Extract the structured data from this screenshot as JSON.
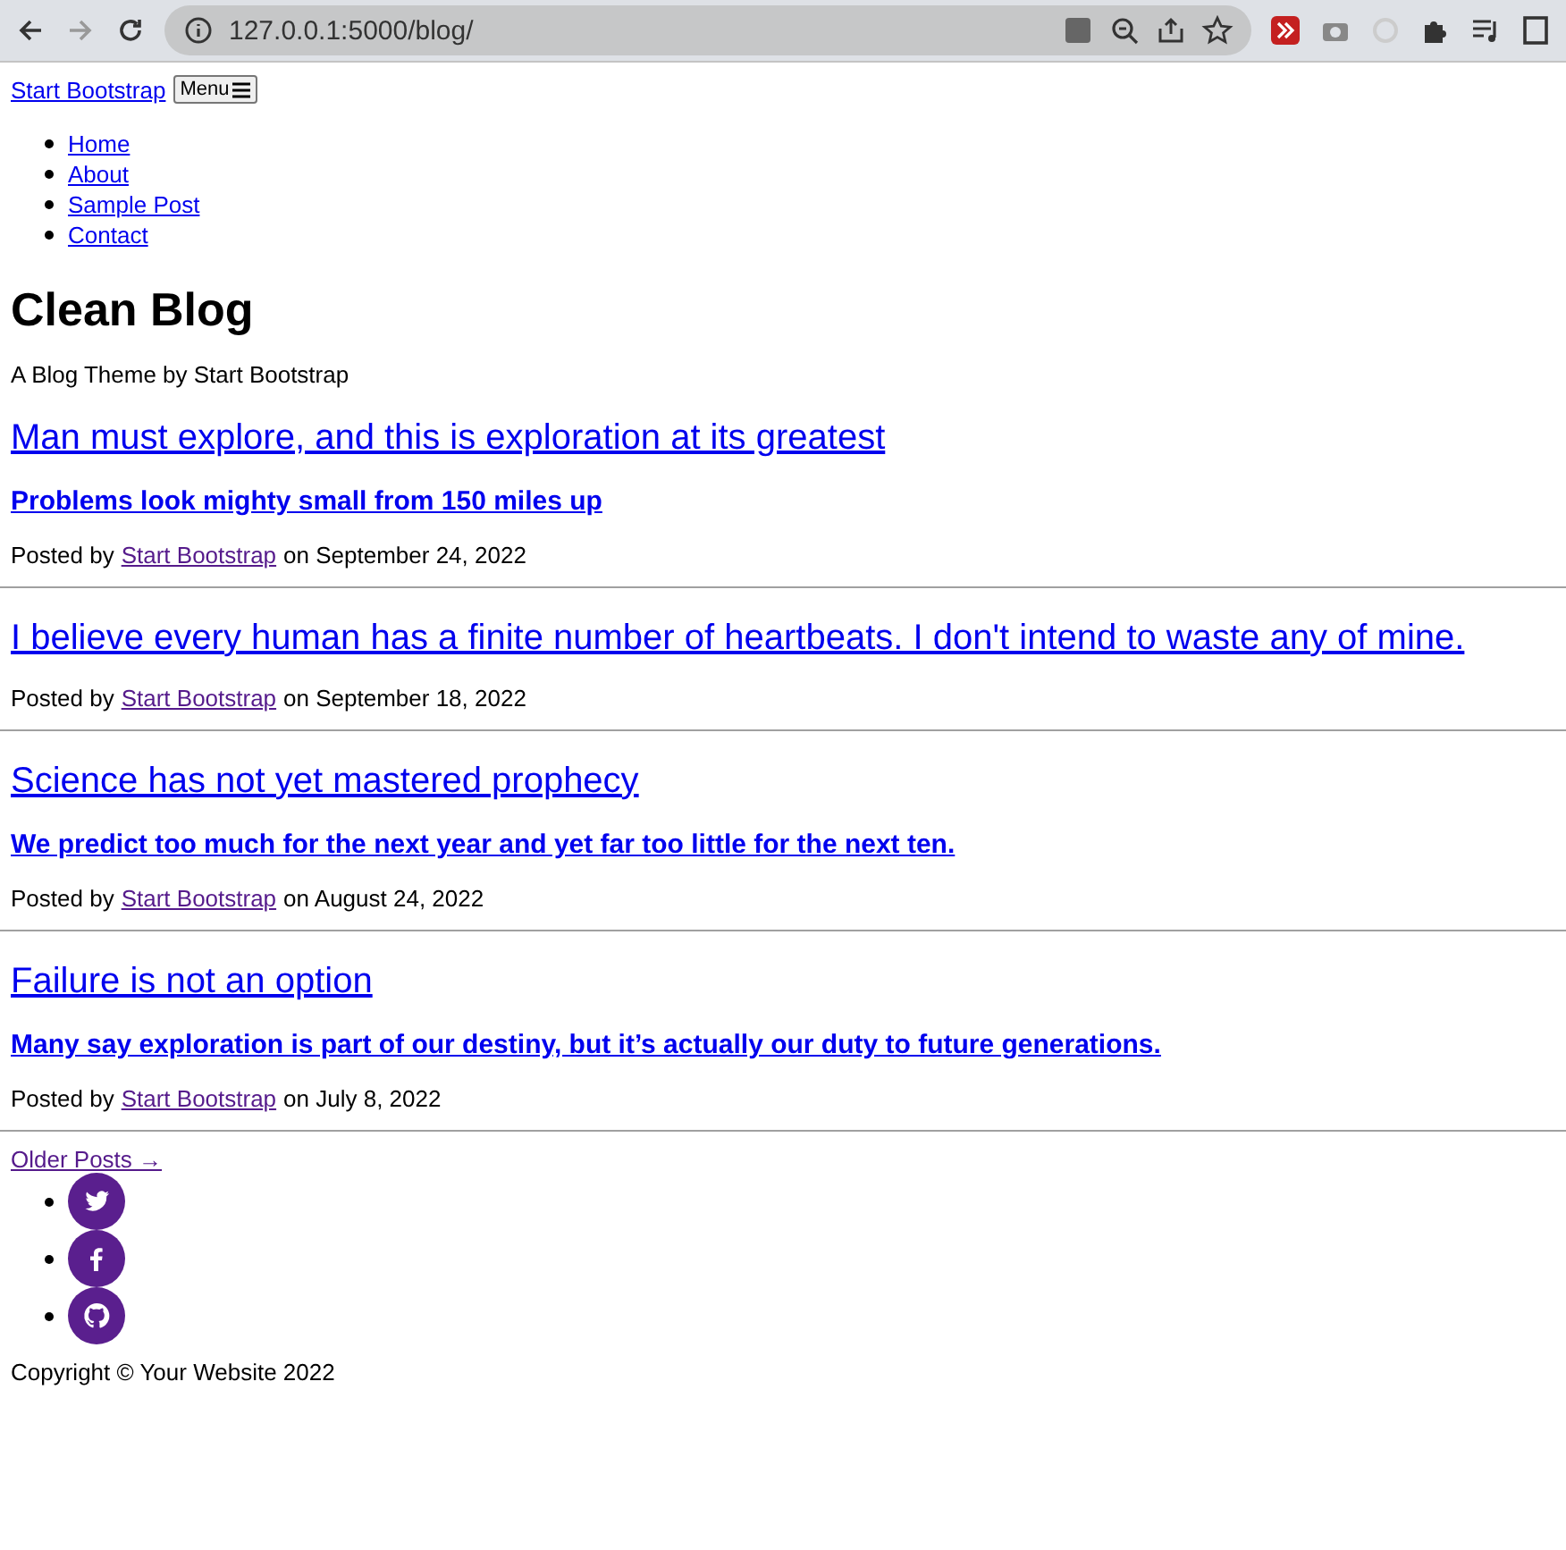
{
  "browser": {
    "url": "127.0.0.1:5000/blog/"
  },
  "navbar": {
    "brand": "Start Bootstrap",
    "menu_button": "Menu",
    "links": [
      {
        "label": "Home"
      },
      {
        "label": "About"
      },
      {
        "label": "Sample Post"
      },
      {
        "label": "Contact"
      }
    ]
  },
  "header": {
    "title": "Clean Blog",
    "subtitle": "A Blog Theme by Start Bootstrap"
  },
  "posts": [
    {
      "title": "Man must explore, and this is exploration at its greatest",
      "subtitle": "Problems look mighty small from 150 miles up",
      "posted_by": "Posted by",
      "author": "Start Bootstrap",
      "author_visited": true,
      "date": "on September 24, 2022"
    },
    {
      "title": "I believe every human has a finite number of heartbeats. I don't intend to waste any of mine.",
      "posted_by": "Posted by",
      "author": "Start Bootstrap",
      "author_visited": true,
      "date": "on September 18, 2022"
    },
    {
      "title": "Science has not yet mastered prophecy",
      "subtitle": "We predict too much for the next year and yet far too little for the next ten.",
      "posted_by": "Posted by",
      "author": "Start Bootstrap",
      "author_visited": true,
      "date": "on August 24, 2022"
    },
    {
      "title": "Failure is not an option",
      "subtitle": "Many say exploration is part of our destiny, but it’s actually our duty to future generations.",
      "posted_by": "Posted by",
      "author": "Start Bootstrap",
      "author_visited": true,
      "date": "on July 8, 2022"
    }
  ],
  "older_posts": {
    "label": "Older Posts →",
    "visited": true
  },
  "social": [
    {
      "kind": "twitter"
    },
    {
      "kind": "facebook"
    },
    {
      "kind": "github"
    }
  ],
  "footer": {
    "copyright": "Copyright © Your Website 2022"
  }
}
